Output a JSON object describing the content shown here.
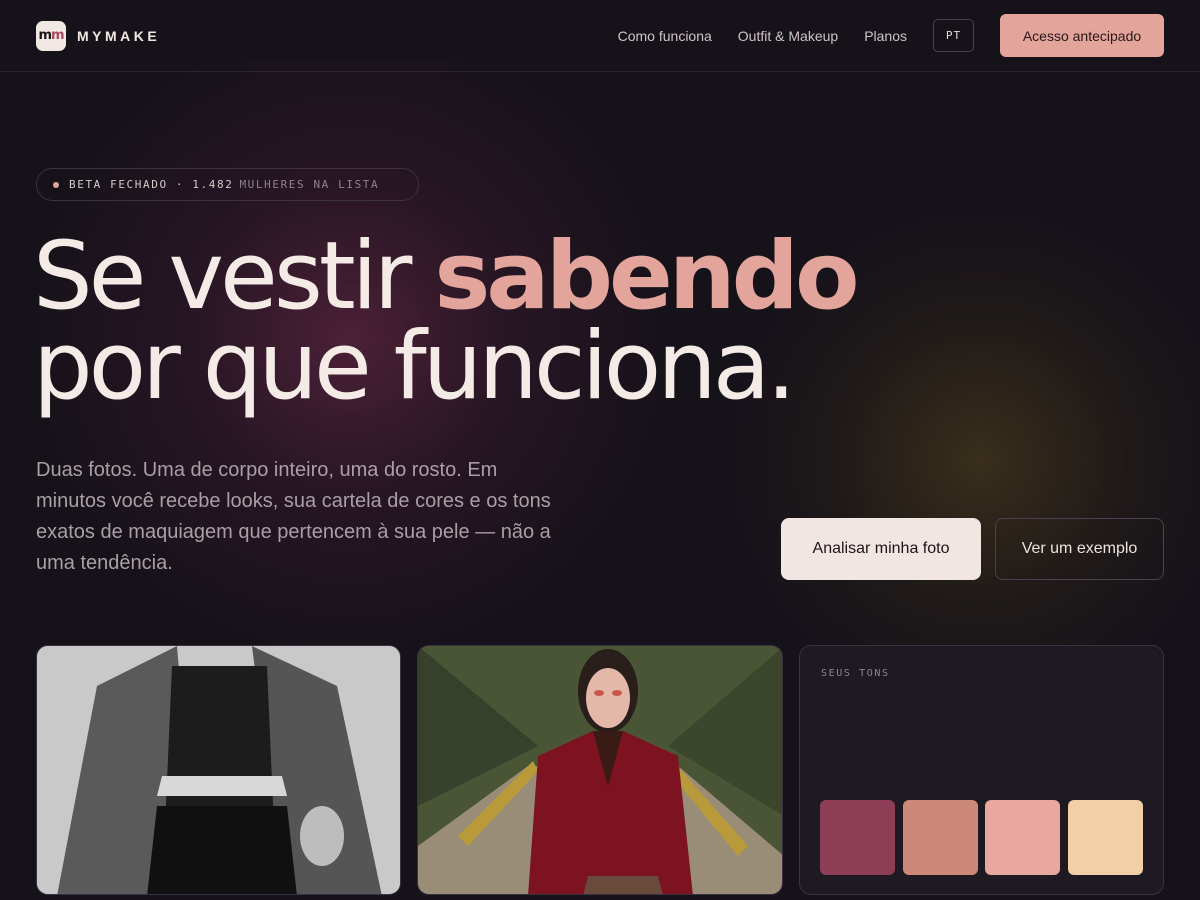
{
  "nav": {
    "logo_mark": "mm",
    "brand": "MYMAKE",
    "links": [
      "Como funciona",
      "Outfit & Makeup",
      "Planos"
    ],
    "lang": "PT",
    "cta": "Acesso antecipado"
  },
  "hero": {
    "badge_strong": "BETA FECHADO · 1.482",
    "badge_muted": "MULHERES NA LISTA",
    "headline_part1": "Se vestir ",
    "headline_accent": "sabendo",
    "headline_line2": "por que funciona.",
    "subtitle": "Duas fotos. Uma de corpo inteiro, uma do rosto. Em minutos você recebe looks, sua cartela de cores e os tons exatos de maquiagem que pertencem à sua pele — não a uma tendência.",
    "primary_button": "Analisar minha foto",
    "secondary_button": "Ver um exemplo"
  },
  "tones_card": {
    "label": "SEUS TONS",
    "swatches": [
      "#8e3d57",
      "#cc8878",
      "#e8a8a0",
      "#f2cfa4"
    ]
  },
  "colors": {
    "background": "#16121a",
    "accent": "#e3a49c",
    "text": "#f1e7e2"
  }
}
